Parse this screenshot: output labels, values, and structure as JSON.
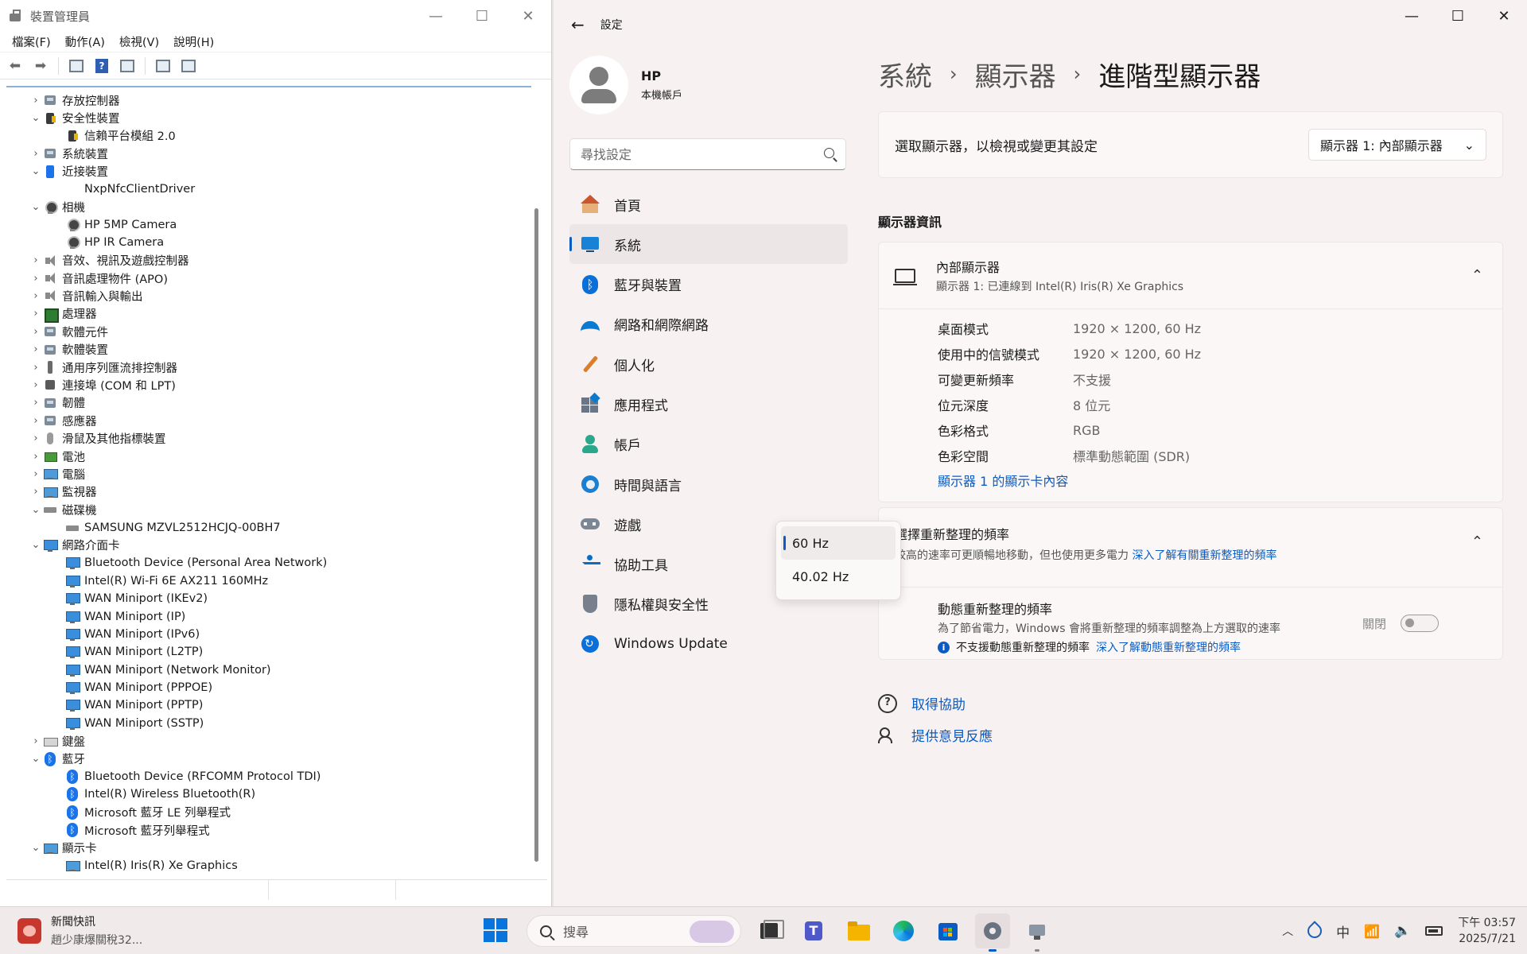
{
  "device_manager": {
    "title": "裝置管理員",
    "menu": [
      "檔案(F)",
      "動作(A)",
      "檢視(V)",
      "說明(H)"
    ],
    "tree": [
      {
        "level": 0,
        "state": "collapsed",
        "icon": "storage-controller-icon",
        "label": "存放控制器"
      },
      {
        "level": 0,
        "state": "expanded",
        "icon": "security-device-icon",
        "label": "安全性裝置"
      },
      {
        "level": 1,
        "state": "leaf",
        "icon": "security-device-icon",
        "label": "信賴平台模組 2.0"
      },
      {
        "level": 0,
        "state": "collapsed",
        "icon": "system-device-icon",
        "label": "系統裝置"
      },
      {
        "level": 0,
        "state": "expanded",
        "icon": "proximity-device-icon",
        "label": "近接裝置"
      },
      {
        "level": 1,
        "state": "leaf",
        "icon": "none",
        "label": "NxpNfcClientDriver"
      },
      {
        "level": 0,
        "state": "expanded",
        "icon": "camera-icon",
        "label": "相機"
      },
      {
        "level": 1,
        "state": "leaf",
        "icon": "camera-icon",
        "label": "HP 5MP Camera"
      },
      {
        "level": 1,
        "state": "leaf",
        "icon": "camera-icon",
        "label": "HP IR Camera"
      },
      {
        "level": 0,
        "state": "collapsed",
        "icon": "speaker-icon",
        "label": "音效、視訊及遊戲控制器"
      },
      {
        "level": 0,
        "state": "collapsed",
        "icon": "speaker-icon",
        "label": "音訊處理物件 (APO)"
      },
      {
        "level": 0,
        "state": "collapsed",
        "icon": "speaker-icon",
        "label": "音訊輸入與輸出"
      },
      {
        "level": 0,
        "state": "collapsed",
        "icon": "processor-icon",
        "label": "處理器"
      },
      {
        "level": 0,
        "state": "collapsed",
        "icon": "software-component-icon",
        "label": "軟體元件"
      },
      {
        "level": 0,
        "state": "collapsed",
        "icon": "software-device-icon",
        "label": "軟體裝置"
      },
      {
        "level": 0,
        "state": "collapsed",
        "icon": "usb-icon",
        "label": "通用序列匯流排控制器"
      },
      {
        "level": 0,
        "state": "collapsed",
        "icon": "port-icon",
        "label": "連接埠 (COM 和 LPT)"
      },
      {
        "level": 0,
        "state": "collapsed",
        "icon": "firmware-icon",
        "label": "韌體"
      },
      {
        "level": 0,
        "state": "collapsed",
        "icon": "sensor-icon",
        "label": "感應器"
      },
      {
        "level": 0,
        "state": "collapsed",
        "icon": "mouse-icon",
        "label": "滑鼠及其他指標裝置"
      },
      {
        "level": 0,
        "state": "collapsed",
        "icon": "battery-icon",
        "label": "電池"
      },
      {
        "level": 0,
        "state": "collapsed",
        "icon": "computer-icon",
        "label": "電腦"
      },
      {
        "level": 0,
        "state": "collapsed",
        "icon": "monitor-icon",
        "label": "監視器"
      },
      {
        "level": 0,
        "state": "expanded",
        "icon": "disk-drive-icon",
        "label": "磁碟機"
      },
      {
        "level": 1,
        "state": "leaf",
        "icon": "disk-drive-icon",
        "label": "SAMSUNG MZVL2512HCJQ-00BH7"
      },
      {
        "level": 0,
        "state": "expanded",
        "icon": "network-adapter-icon",
        "label": "網路介面卡"
      },
      {
        "level": 1,
        "state": "leaf",
        "icon": "network-adapter-icon",
        "label": "Bluetooth Device (Personal Area Network)"
      },
      {
        "level": 1,
        "state": "leaf",
        "icon": "network-adapter-icon",
        "label": "Intel(R) Wi-Fi 6E AX211 160MHz"
      },
      {
        "level": 1,
        "state": "leaf",
        "icon": "network-adapter-icon",
        "label": "WAN Miniport (IKEv2)"
      },
      {
        "level": 1,
        "state": "leaf",
        "icon": "network-adapter-icon",
        "label": "WAN Miniport (IP)"
      },
      {
        "level": 1,
        "state": "leaf",
        "icon": "network-adapter-icon",
        "label": "WAN Miniport (IPv6)"
      },
      {
        "level": 1,
        "state": "leaf",
        "icon": "network-adapter-icon",
        "label": "WAN Miniport (L2TP)"
      },
      {
        "level": 1,
        "state": "leaf",
        "icon": "network-adapter-icon",
        "label": "WAN Miniport (Network Monitor)"
      },
      {
        "level": 1,
        "state": "leaf",
        "icon": "network-adapter-icon",
        "label": "WAN Miniport (PPPOE)"
      },
      {
        "level": 1,
        "state": "leaf",
        "icon": "network-adapter-icon",
        "label": "WAN Miniport (PPTP)"
      },
      {
        "level": 1,
        "state": "leaf",
        "icon": "network-adapter-icon",
        "label": "WAN Miniport (SSTP)"
      },
      {
        "level": 0,
        "state": "collapsed",
        "icon": "keyboard-icon",
        "label": "鍵盤"
      },
      {
        "level": 0,
        "state": "expanded",
        "icon": "bluetooth-icon",
        "label": "藍牙"
      },
      {
        "level": 1,
        "state": "leaf",
        "icon": "bluetooth-icon",
        "label": "Bluetooth Device (RFCOMM Protocol TDI)"
      },
      {
        "level": 1,
        "state": "leaf",
        "icon": "bluetooth-icon",
        "label": "Intel(R) Wireless Bluetooth(R)"
      },
      {
        "level": 1,
        "state": "leaf",
        "icon": "bluetooth-icon",
        "label": "Microsoft 藍牙 LE 列舉程式"
      },
      {
        "level": 1,
        "state": "leaf",
        "icon": "bluetooth-icon",
        "label": "Microsoft 藍牙列舉程式"
      },
      {
        "level": 0,
        "state": "expanded",
        "icon": "display-adapter-icon",
        "label": "顯示卡"
      },
      {
        "level": 1,
        "state": "leaf",
        "icon": "display-adapter-icon",
        "label": "Intel(R) Iris(R) Xe Graphics"
      }
    ]
  },
  "settings": {
    "title": "設定",
    "profile": {
      "name": "HP",
      "sub": "本機帳戶"
    },
    "search_placeholder": "尋找設定",
    "nav": [
      {
        "label": "首頁",
        "icon": "home-icon",
        "selected": false
      },
      {
        "label": "系統",
        "icon": "system-icon",
        "selected": true
      },
      {
        "label": "藍牙與裝置",
        "icon": "bluetooth-icon",
        "selected": false
      },
      {
        "label": "網路和網際網路",
        "icon": "network-icon",
        "selected": false
      },
      {
        "label": "個人化",
        "icon": "brush-icon",
        "selected": false
      },
      {
        "label": "應用程式",
        "icon": "apps-icon",
        "selected": false
      },
      {
        "label": "帳戶",
        "icon": "account-icon",
        "selected": false
      },
      {
        "label": "時間與語言",
        "icon": "globe-clock-icon",
        "selected": false
      },
      {
        "label": "遊戲",
        "icon": "gamepad-icon",
        "selected": false
      },
      {
        "label": "協助工具",
        "icon": "accessibility-icon",
        "selected": false
      },
      {
        "label": "隱私權與安全性",
        "icon": "shield-icon",
        "selected": false
      },
      {
        "label": "Windows Update",
        "icon": "update-icon",
        "selected": false
      }
    ],
    "breadcrumb": {
      "c1": "系統",
      "c2": "顯示器",
      "current": "進階型顯示器",
      "sep": "›"
    },
    "choose_display": {
      "label": "選取顯示器，以檢視或變更其設定",
      "value": "顯示器 1: 內部顯示器"
    },
    "info_section_title": "顯示器資訊",
    "display_info": {
      "name": "內部顯示器",
      "sub": "顯示器 1: 已連線到 Intel(R) Iris(R) Xe Graphics",
      "rows": [
        {
          "k": "桌面模式",
          "v": "1920 × 1200, 60 Hz"
        },
        {
          "k": "使用中的信號模式",
          "v": "1920 × 1200, 60 Hz"
        },
        {
          "k": "可變更新頻率",
          "v": "不支援"
        },
        {
          "k": "位元深度",
          "v": "8 位元"
        },
        {
          "k": "色彩格式",
          "v": "RGB"
        },
        {
          "k": "色彩空間",
          "v": "標準動態範圍 (SDR)"
        }
      ],
      "adapter_link": "顯示器 1 的顯示卡內容"
    },
    "refresh": {
      "title": "選擇重新整理的頻率",
      "desc": "較高的速率可更順暢地移動，但也使用更多電力",
      "desc_link": "深入了解有關重新整理的頻率",
      "options": [
        "60 Hz",
        "40.02 Hz"
      ],
      "selected": "60 Hz",
      "dynamic": {
        "title": "動態重新整理的頻率",
        "desc": "為了節省電力，Windows 會將重新整理的頻率調整為上方選取的速率",
        "note": "不支援動態重新整理的頻率",
        "note_link": "深入了解動態重新整理的頻率",
        "toggle_label": "關閉"
      }
    },
    "help": {
      "get_help": "取得協助",
      "feedback": "提供意見反應"
    }
  },
  "taskbar": {
    "news_title": "新聞快訊",
    "news_sub": "趙少康爆關稅32...",
    "search_placeholder": "搜尋",
    "tray_ime": "中",
    "time": "下午 03:57",
    "date": "2025/7/21"
  },
  "colors": {
    "accent": "#0a5cc4",
    "settings_bg": "#f7f1f1",
    "taskbar_bg": "#f1eaea"
  }
}
